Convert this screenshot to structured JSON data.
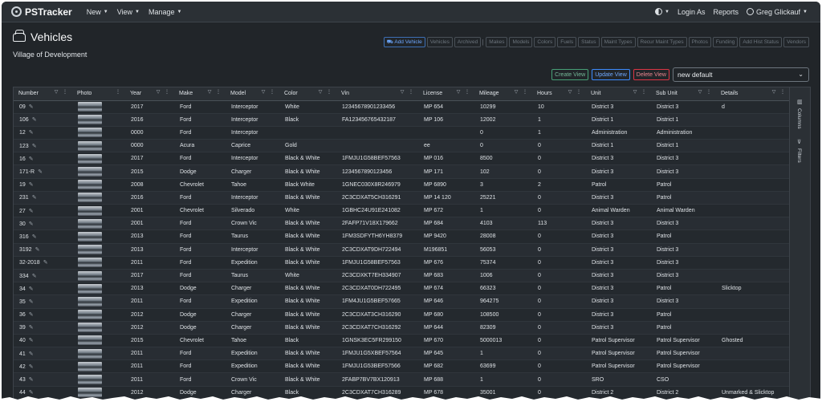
{
  "navbar": {
    "brand": "PSTracker",
    "menus": [
      "New",
      "View",
      "Manage"
    ],
    "login_as": "Login As",
    "reports": "Reports",
    "user": "Greg Glickauf"
  },
  "header": {
    "title": "Vehicles",
    "subtitle": "Village of Development"
  },
  "toolbar": {
    "add_vehicle": "Add Vehicle",
    "buttons_group1": [
      "Vehicles",
      "Archived"
    ],
    "buttons_group2": [
      "Makes",
      "Models",
      "Colors",
      "Fuels",
      "Status",
      "Maint Types",
      "Recur Maint Types",
      "Photos",
      "Funding",
      "Add Hist Status",
      "Vendors"
    ]
  },
  "views": {
    "create": "Create View",
    "update": "Update View",
    "delete": "Delete View",
    "selected": "new default"
  },
  "grid": {
    "columns": [
      "Number",
      "Photo",
      "Year",
      "Make",
      "Model",
      "Color",
      "Vin",
      "License",
      "Mileage",
      "Hours",
      "Unit",
      "Sub Unit",
      "Details"
    ],
    "rows": [
      [
        "09",
        "2017",
        "Ford",
        "Interceptor",
        "White",
        "12345678901233456",
        "MP 654",
        "10299",
        "10",
        "District 3",
        "District 3",
        "d"
      ],
      [
        "106",
        "2016",
        "Ford",
        "Interceptor",
        "Black",
        "FA123456765432187",
        "MP 106",
        "12002",
        "1",
        "District 1",
        "District 1",
        ""
      ],
      [
        "12",
        "0000",
        "Ford",
        "Interceptor",
        "",
        "",
        "",
        "0",
        "1",
        "Administration",
        "Administration",
        ""
      ],
      [
        "123",
        "0000",
        "Acura",
        "Caprice",
        "Gold",
        "",
        "ee",
        "0",
        "0",
        "District 1",
        "District 1",
        ""
      ],
      [
        "16",
        "2017",
        "Ford",
        "Interceptor",
        "Black & White",
        "1FMJU1G58BEF57563",
        "MP 016",
        "8500",
        "0",
        "District 3",
        "District 3",
        ""
      ],
      [
        "171-R",
        "2015",
        "Dodge",
        "Charger",
        "Black & White",
        "1234567890123456",
        "MP 171",
        "102",
        "0",
        "District 3",
        "District 3",
        ""
      ],
      [
        "19",
        "2008",
        "Chevrolet",
        "Tahoe",
        "Black White",
        "1GNEC030X8R246979",
        "MP 6890",
        "3",
        "2",
        "Patrol",
        "Patrol",
        ""
      ],
      [
        "231",
        "2016",
        "Ford",
        "Interceptor",
        "Black & White",
        "2C3CDXAT5CH316291",
        "MP 14 120",
        "25221",
        "0",
        "District 3",
        "Patrol",
        ""
      ],
      [
        "27",
        "2001",
        "Chevrolet",
        "Silverado",
        "White",
        "1GBHC24U91E241082",
        "MP 672",
        "1",
        "0",
        "Animal Warden",
        "Animal Warden",
        ""
      ],
      [
        "30",
        "2001",
        "Ford",
        "Crown Vic",
        "Black & White",
        "2FAFP71V18X179662",
        "MP 684",
        "4103",
        "113",
        "District 3",
        "District 3",
        ""
      ],
      [
        "316",
        "2013",
        "Ford",
        "Taurus",
        "Black & White",
        "1FM3SDFYTH6YH8379",
        "MP 9420",
        "28008",
        "0",
        "District 3",
        "Patrol",
        ""
      ],
      [
        "3192",
        "2013",
        "Ford",
        "Interceptor",
        "Black & White",
        "2C3CDXAT9DH722494",
        "M196851",
        "56053",
        "0",
        "District 3",
        "District 3",
        ""
      ],
      [
        "32-2018",
        "2011",
        "Ford",
        "Expedition",
        "Black & White",
        "1FMJU1G58BEF57563",
        "MP 676",
        "75374",
        "0",
        "District 3",
        "District 3",
        ""
      ],
      [
        "334",
        "2017",
        "Ford",
        "Taurus",
        "White",
        "2C3CDXKT7EH334907",
        "MP 683",
        "1006",
        "0",
        "District 3",
        "District 3",
        ""
      ],
      [
        "34",
        "2013",
        "Dodge",
        "Charger",
        "Black & White",
        "2C3CDXAT0DH722495",
        "MP 674",
        "66323",
        "0",
        "District 3",
        "Patrol",
        "Slicktop"
      ],
      [
        "35",
        "2011",
        "Ford",
        "Expedition",
        "Black & White",
        "1FM4JU1G5BEF57665",
        "MP 646",
        "964275",
        "0",
        "District 3",
        "District 3",
        ""
      ],
      [
        "36",
        "2012",
        "Dodge",
        "Charger",
        "Black & White",
        "2C3CDXAT3CH316290",
        "MP 680",
        "108500",
        "0",
        "District 3",
        "Patrol",
        ""
      ],
      [
        "39",
        "2012",
        "Dodge",
        "Charger",
        "Black & White",
        "2C3CDXAT7CH316292",
        "MP 644",
        "82309",
        "0",
        "District 3",
        "Patrol",
        ""
      ],
      [
        "40",
        "2015",
        "Chevrolet",
        "Tahoe",
        "Black",
        "1GNSK3EC5FR299150",
        "MP 670",
        "5000013",
        "0",
        "Patrol Supervisor",
        "Patrol Supervisor",
        "Ghosted"
      ],
      [
        "41",
        "2011",
        "Ford",
        "Expedition",
        "Black & White",
        "1FMJU1G5XBEF57564",
        "MP 645",
        "1",
        "0",
        "Patrol Supervisor",
        "Patrol Supervisor",
        ""
      ],
      [
        "42",
        "2011",
        "Ford",
        "Expedition",
        "Black & White",
        "1FMJU1G53BEF57566",
        "MP 682",
        "63699",
        "0",
        "Patrol Supervisor",
        "Patrol Supervisor",
        ""
      ],
      [
        "43",
        "2011",
        "Ford",
        "Crown Vic",
        "Black & White",
        "2FABP7BV7BX120913",
        "MP 688",
        "1",
        "0",
        "SRO",
        "CSO",
        ""
      ],
      [
        "44",
        "2012",
        "Dodge",
        "Charger",
        "Black",
        "2C3CDXAT7CH316289",
        "MP 678",
        "35001",
        "0",
        "District 2",
        "District 2",
        "Unmarked & Slicktop"
      ]
    ],
    "side_tabs": [
      "Columns",
      "Filters"
    ]
  },
  "colors": {
    "background": "#212529",
    "navbar": "#2b3035",
    "primary": "#6ea8fe",
    "success": "#75b798",
    "danger": "#ea868f"
  },
  "icons": {
    "brand": "badge-icon",
    "page": "car-icon",
    "edit": "pencil-icon",
    "theme": "contrast-icon",
    "user": "user-circle-icon"
  }
}
